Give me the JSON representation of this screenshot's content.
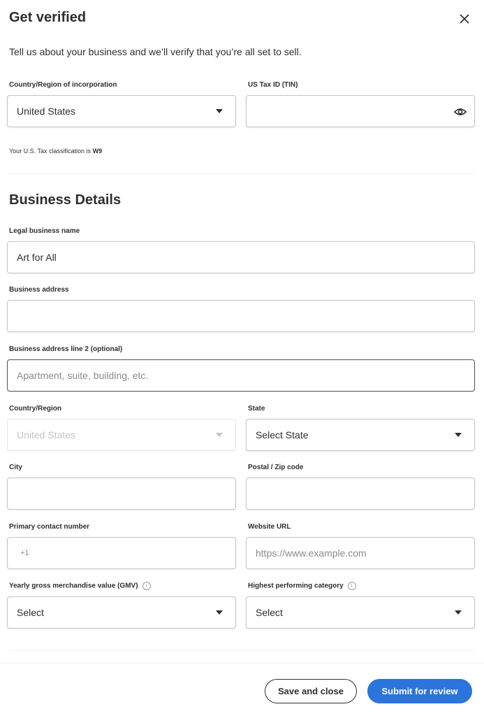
{
  "dialog": {
    "title": "Get verified",
    "subtitle": "Tell us about your business and we’ll verify that you’re all set to sell.",
    "close_icon": "close-icon"
  },
  "incorporation": {
    "country_label": "Country/Region of incorporation",
    "country_value": "United States",
    "tin_label": "US Tax ID (TIN)",
    "tin_value": "",
    "tin_icon": "eye-icon",
    "tax_note_prefix": "Your U.S. Tax classification is",
    "tax_classification": "W9"
  },
  "business_details": {
    "heading": "Business Details",
    "legal_name_label": "Legal business name",
    "legal_name_value": "Art for All",
    "address_label": "Business address",
    "address_value": "",
    "address2_label": "Business address line 2 (optional)",
    "address2_placeholder": "Apartment, suite, building, etc.",
    "country_label": "Country/Region",
    "country_value": "United States",
    "state_label": "State",
    "state_value": "Select State",
    "city_label": "City",
    "city_value": "",
    "zip_label": "Postal / Zip code",
    "zip_value": "",
    "phone_label": "Primary contact number",
    "phone_prefix": "+1",
    "website_label": "Website URL",
    "website_placeholder": "https://www.example.com",
    "gmv_label": "Yearly gross merchandise value (GMV)",
    "gmv_value": "Select",
    "category_label": "Highest performing category",
    "category_value": "Select",
    "info_icon_glyph": "i"
  },
  "footer": {
    "save_label": "Save and close",
    "submit_label": "Submit for review"
  },
  "colors": {
    "primary": "#2a74dc",
    "text": "#2e2f32"
  }
}
